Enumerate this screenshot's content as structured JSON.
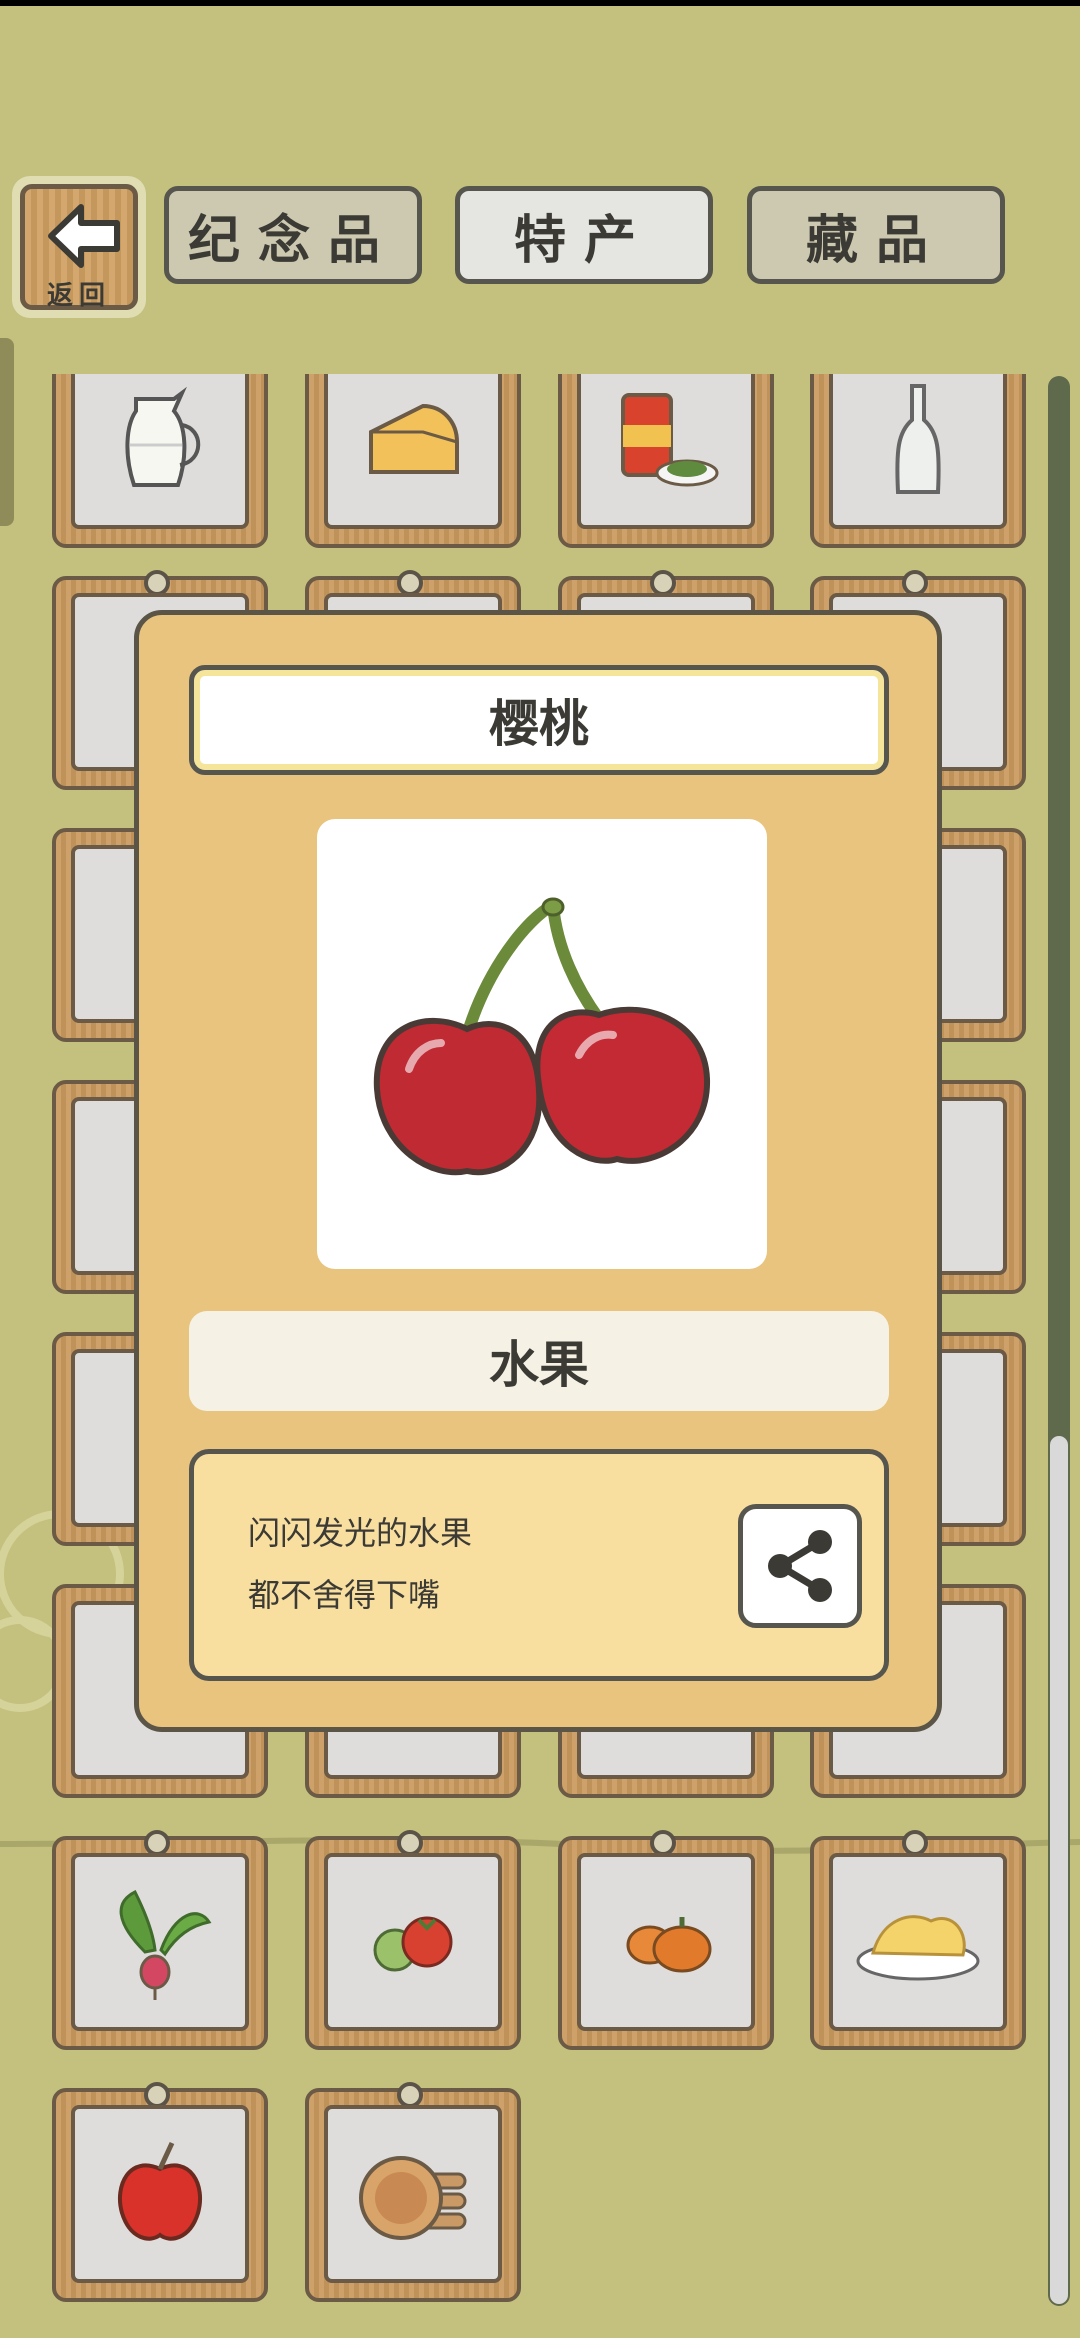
{
  "header": {
    "back_label": "返回",
    "tabs": [
      {
        "label": "纪念品"
      },
      {
        "label": "特产"
      },
      {
        "label": "藏品"
      }
    ]
  },
  "detail": {
    "name": "樱桃",
    "category": "水果",
    "description_lines": [
      "闪闪发光的水果",
      "都不舍得下嘴"
    ]
  },
  "grid_items": [
    "milk-jug-icon",
    "cheese-icon",
    "tea-can-icon",
    "bottle-icon",
    "food-icon",
    "food-icon",
    "food-icon",
    "orange-icon",
    "dish-icon",
    "dish-icon",
    "dish-icon",
    "leaf-icon",
    "apple-icon",
    "food-icon",
    "food-icon",
    "book-icon",
    "bag-icon",
    "food-icon",
    "food-icon",
    "basket-icon",
    "bread-icon",
    "food-icon",
    "food-icon",
    "carrot-icon",
    "radish-icon",
    "tomato-icon",
    "pumpkin-icon",
    "pasta-icon",
    "apple-icon",
    "pancake-icon"
  ],
  "colors": {
    "background": "#c4c07e",
    "modal": "#e8c47e",
    "cherry": "#c02a33"
  }
}
